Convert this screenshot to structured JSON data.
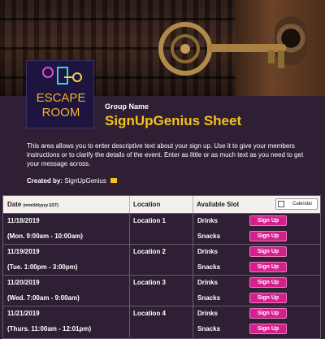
{
  "logo": {
    "line1": "ESCAPE",
    "line2": "ROOM"
  },
  "header": {
    "group_label": "Group Name",
    "title": "SignUpGenius Sheet"
  },
  "description": "This area allows you to enter descriptive text about your sign up. Use it to give your members instructions or to clarify the details of the event. Enter as little or as much text as you need to get your message across.",
  "created_by": {
    "label": "Created by:",
    "name": "SignUpGenius"
  },
  "table": {
    "columns": {
      "date": "Date",
      "date_format": "(mm/dd/yyyy EST)",
      "location": "Location",
      "slot": "Available Slot",
      "calendar_button": "Calendar"
    },
    "rows": [
      {
        "date": "11/18/2019",
        "time": "(Mon. 9:00am - 10:00am)",
        "location": "Location 1",
        "slots": [
          {
            "label": "Drinks",
            "button": "Sign Up"
          },
          {
            "label": "Snacks",
            "button": "Sign Up"
          }
        ]
      },
      {
        "date": "11/19/2019",
        "time": "(Tue. 1:00pm - 3:00pm)",
        "location": "Location 2",
        "slots": [
          {
            "label": "Drinks",
            "button": "Sign Up"
          },
          {
            "label": "Snacks",
            "button": "Sign Up"
          }
        ]
      },
      {
        "date": "11/20/2019",
        "time": "(Wed. 7:00am - 9:00am)",
        "location": "Location 3",
        "slots": [
          {
            "label": "Drinks",
            "button": "Sign Up"
          },
          {
            "label": "Snacks",
            "button": "Sign Up"
          }
        ]
      },
      {
        "date": "11/21/2019",
        "time": "(Thurs. 11:00am - 12:01pm)",
        "location": "Location 4",
        "slots": [
          {
            "label": "Drinks",
            "button": "Sign Up"
          },
          {
            "label": "Snacks",
            "button": "Sign Up"
          }
        ]
      }
    ]
  },
  "colors": {
    "background": "#2e1f35",
    "title_accent": "#f4c21a",
    "signup_button": "#d61f8e",
    "header_row": "#f3f0ee"
  },
  "icons": [
    "key-icon",
    "keyhole-icon",
    "escape-room-logo",
    "mail-icon",
    "calendar-icon"
  ]
}
